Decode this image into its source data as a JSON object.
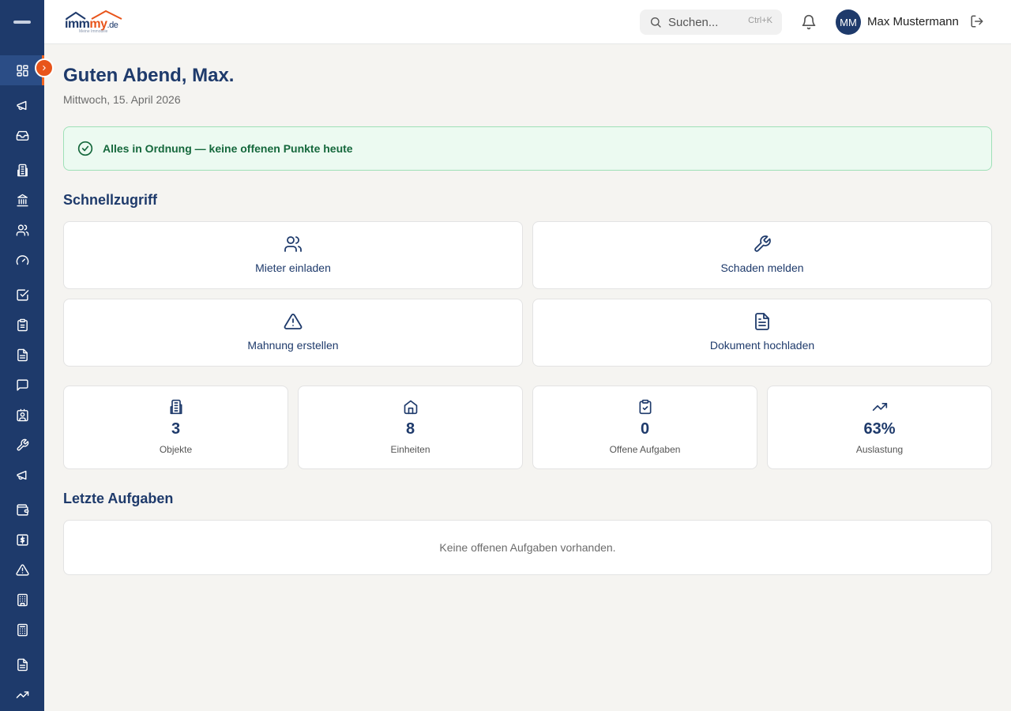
{
  "brand": {
    "name_main": "imm",
    "name_accent": "my",
    "tld": ".de",
    "tagline": "Meine Immobilie"
  },
  "header": {
    "search_placeholder": "Suchen...",
    "search_shortcut": "Ctrl+K",
    "user_initials": "MM",
    "user_name": "Max Mustermann"
  },
  "sidebar": {
    "items": [
      {
        "icon": "dashboard-icon"
      },
      {
        "icon": "megaphone-icon"
      },
      {
        "icon": "inbox-icon"
      },
      {
        "icon": "building-icon"
      },
      {
        "icon": "library-icon"
      },
      {
        "icon": "users-icon"
      },
      {
        "icon": "gauge-icon"
      },
      {
        "icon": "checkbox-icon"
      },
      {
        "icon": "clipboard-icon"
      },
      {
        "icon": "file-text-icon"
      },
      {
        "icon": "message-icon"
      },
      {
        "icon": "contact-icon"
      },
      {
        "icon": "wrench-icon"
      },
      {
        "icon": "megaphone-icon"
      },
      {
        "icon": "wallet-icon"
      },
      {
        "icon": "dollar-icon"
      },
      {
        "icon": "alert-icon"
      },
      {
        "icon": "building-2-icon"
      },
      {
        "icon": "calculator-icon"
      },
      {
        "icon": "file-icon"
      },
      {
        "icon": "trending-icon"
      }
    ]
  },
  "main": {
    "greeting": "Guten Abend, Max.",
    "date": "Mittwoch, 15. April 2026",
    "alert": "Alles in Ordnung — keine offenen Punkte heute",
    "quick_access_title": "Schnellzugriff",
    "quick_actions": [
      {
        "label": "Mieter einladen",
        "icon": "users-icon"
      },
      {
        "label": "Schaden melden",
        "icon": "wrench-icon"
      },
      {
        "label": "Mahnung erstellen",
        "icon": "warning-icon"
      },
      {
        "label": "Dokument hochladen",
        "icon": "document-icon"
      }
    ],
    "stats": [
      {
        "value": "3",
        "label": "Objekte",
        "icon": "building-icon"
      },
      {
        "value": "8",
        "label": "Einheiten",
        "icon": "house-icon"
      },
      {
        "value": "0",
        "label": "Offene Aufgaben",
        "icon": "clipboard-check-icon"
      },
      {
        "value": "63%",
        "label": "Auslastung",
        "icon": "trending-up-icon"
      }
    ],
    "tasks_title": "Letzte Aufgaben",
    "tasks_empty": "Keine offenen Aufgaben vorhanden."
  },
  "colors": {
    "primary": "#1e3a6b",
    "accent": "#e8541a",
    "success_bg": "#ecfaf1",
    "success_text": "#15683c"
  }
}
